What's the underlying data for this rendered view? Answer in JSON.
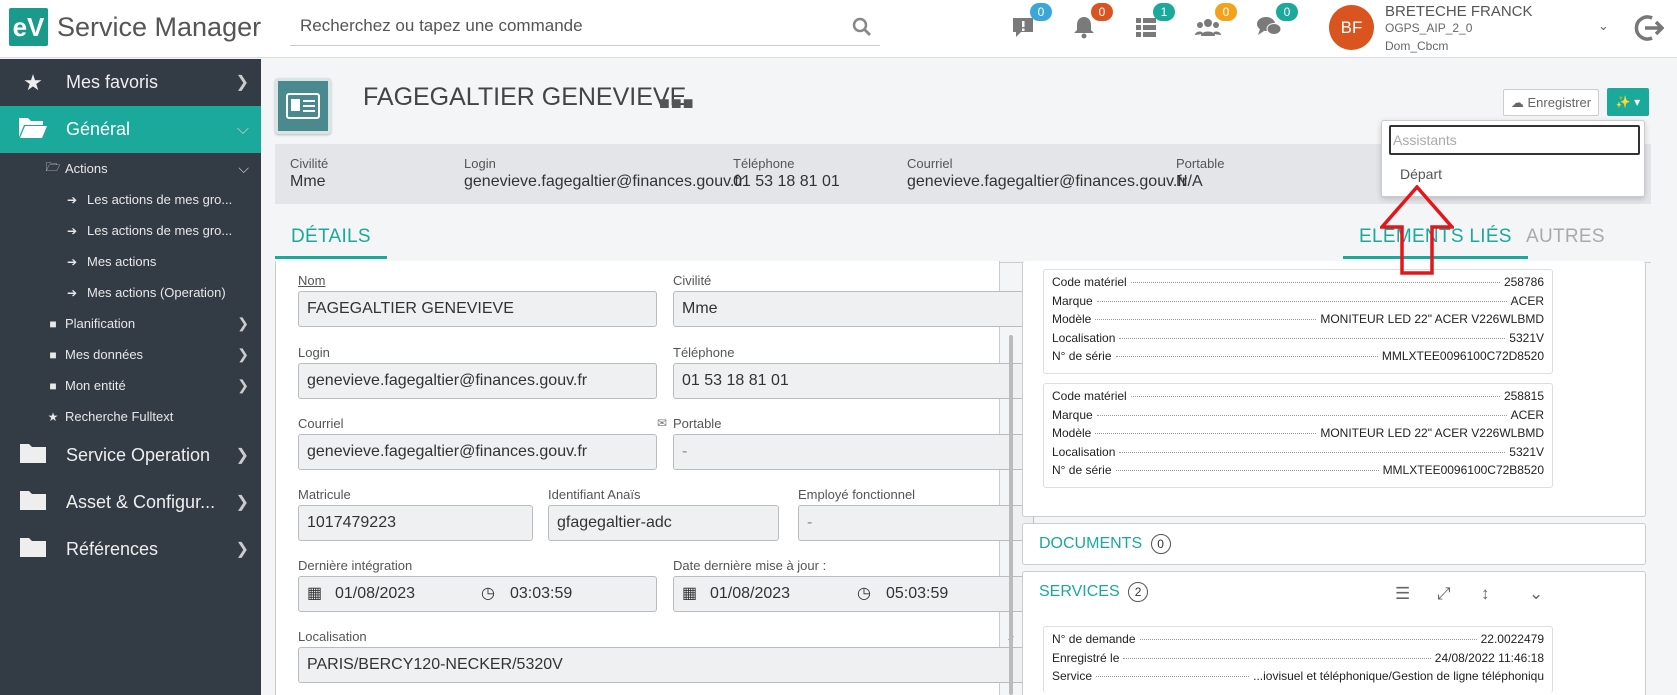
{
  "app": {
    "logo_text": "eV",
    "brand": "Service Manager"
  },
  "search": {
    "placeholder": "Recherchez ou tapez une commande"
  },
  "notifications": [
    {
      "name": "alert-icon",
      "count": "0",
      "color": "#3aa7d8"
    },
    {
      "name": "bell-icon",
      "count": "0",
      "color": "#d9541e"
    },
    {
      "name": "list-icon",
      "count": "1",
      "color": "#1aa99a"
    },
    {
      "name": "group-icon",
      "count": "0",
      "color": "#f2a31b"
    },
    {
      "name": "chat-icon",
      "count": "0",
      "color": "#1aa99a"
    }
  ],
  "user": {
    "initials": "BF",
    "name": "BRETECHE FRANCK",
    "line1": "OGPS_AIP_2_0",
    "line2": "Dom_Cbcm"
  },
  "sidebar": {
    "favoris": "Mes favoris",
    "general": "Général",
    "actions": "Actions",
    "actions_items": [
      "Les actions de mes gro...",
      "Les actions de mes gro...",
      "Mes actions",
      "Mes actions (Operation)"
    ],
    "planification": "Planification",
    "mes_donnees": "Mes données",
    "mon_entite": "Mon entité",
    "recherche": "Recherche Fulltext",
    "service_operation": "Service Operation",
    "asset": "Asset & Configur...",
    "references": "Références"
  },
  "page": {
    "title": "FAGEGALTIER GENEVIEVE",
    "save_label": "Enregistrer"
  },
  "info": {
    "civilite_lbl": "Civilité",
    "civilite": "Mme",
    "login_lbl": "Login",
    "login": "genevieve.fagegaltier@finances.gouv.fr",
    "telephone_lbl": "Téléphone",
    "telephone": "01 53 18 81 01",
    "courriel_lbl": "Courriel",
    "courriel": "genevieve.fagegaltier@finances.gouv.fr",
    "portable_lbl": "Portable",
    "portable": "N/A"
  },
  "tabs": {
    "details": "DÉTAILS",
    "elements": "ELEMENTS LIÉS",
    "autres": "AUTRES"
  },
  "form": {
    "nom_lbl": "Nom",
    "nom": "FAGEGALTIER GENEVIEVE",
    "civilite_lbl": "Civilité",
    "civilite": "Mme",
    "login_lbl": "Login",
    "login": "genevieve.fagegaltier@finances.gouv.fr",
    "telephone_lbl": "Téléphone",
    "telephone": "01 53 18 81 01",
    "courriel_lbl": "Courriel",
    "courriel": "genevieve.fagegaltier@finances.gouv.fr",
    "portable_lbl": "Portable",
    "portable": "-",
    "matricule_lbl": "Matricule",
    "matricule": "1017479223",
    "anais_lbl": "Identifiant Anaïs",
    "anais": "gfagegaltier-adc",
    "employe_lbl": "Employé fonctionnel",
    "employe": "-",
    "derniere_lbl": "Dernière intégration",
    "derniere_date": "01/08/2023",
    "derniere_time": "03:03:59",
    "maj_lbl": "Date dernière mise à jour :",
    "maj_date": "01/08/2023",
    "maj_time": "05:03:59",
    "localisation_lbl": "Localisation",
    "localisation": "PARIS/BERCY120-NECKER/5320V"
  },
  "equipments": [
    {
      "rows": [
        {
          "k": "Code matériel",
          "v": "258786"
        },
        {
          "k": "Marque",
          "v": "ACER"
        },
        {
          "k": "Modèle",
          "v": "MONITEUR LED 22\" ACER V226WLBMD"
        },
        {
          "k": "Localisation",
          "v": "5321V"
        },
        {
          "k": "N° de série",
          "v": "MMLXTEE0096100C72D8520"
        }
      ]
    },
    {
      "rows": [
        {
          "k": "Code matériel",
          "v": "258815"
        },
        {
          "k": "Marque",
          "v": "ACER"
        },
        {
          "k": "Modèle",
          "v": "MONITEUR LED 22\" ACER V226WLBMD"
        },
        {
          "k": "Localisation",
          "v": "5321V"
        },
        {
          "k": "N° de série",
          "v": "MMLXTEE0096100C72B8520"
        }
      ]
    }
  ],
  "documents": {
    "title": "DOCUMENTS",
    "count": "0"
  },
  "services": {
    "title": "SERVICES",
    "count": "2",
    "rows": [
      {
        "k": "N° de demande",
        "v": "22.0022479"
      },
      {
        "k": "Enregistré le",
        "v": "24/08/2022 11:46:18"
      },
      {
        "k": "Service",
        "v": "...iovisuel et téléphonique/Gestion de ligne téléphoniqu"
      }
    ]
  },
  "dropdown": {
    "placeholder": "Assistants",
    "item": "Départ"
  }
}
